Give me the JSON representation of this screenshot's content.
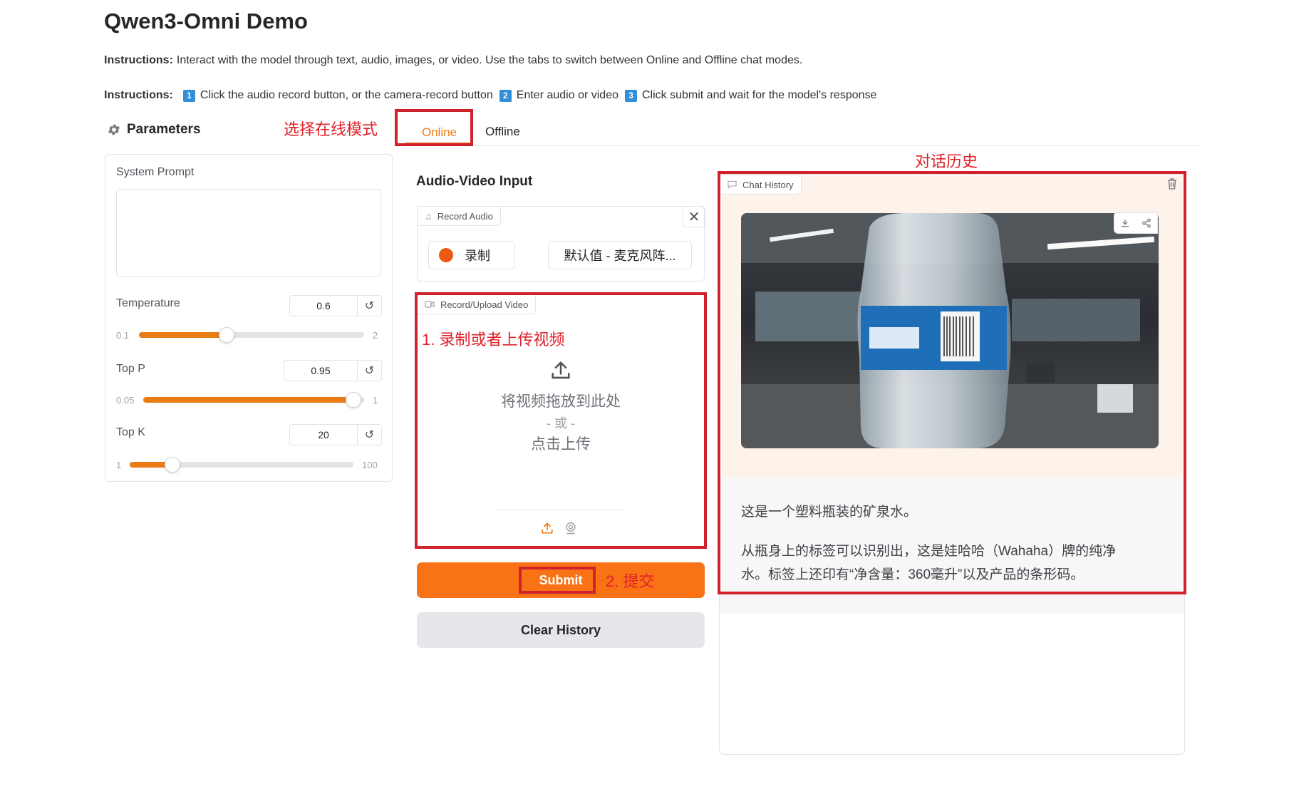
{
  "app": {
    "title": "Qwen3-Omni Demo"
  },
  "instructions": {
    "line1_label": "Instructions:",
    "line1_text": "Interact with the model through text, audio, images, or video. Use the tabs to switch between Online and Offline chat modes.",
    "line2_label": "Instructions:",
    "steps": [
      {
        "num": "1",
        "text": "Click the audio record button, or the camera-record button"
      },
      {
        "num": "2",
        "text": "Enter audio or video"
      },
      {
        "num": "3",
        "text": "Click submit and wait for the model's response"
      }
    ]
  },
  "annotations": {
    "select_online": "选择在线模式",
    "chat_history": "对话历史",
    "record_upload": "1. 录制或者上传视频",
    "submit": "2. 提交",
    "color": "#d0222d"
  },
  "parameters": {
    "header": "Parameters",
    "icon": "gear-icon",
    "system_prompt_label": "System Prompt",
    "system_prompt_value": "",
    "temperature": {
      "label": "Temperature",
      "value": "0.6",
      "min": "0.1",
      "max": "2",
      "fraction": 0.39
    },
    "top_p": {
      "label": "Top P",
      "value": "0.95",
      "min": "0.05",
      "max": "1",
      "fraction": 0.95
    },
    "top_k": {
      "label": "Top K",
      "value": "20",
      "min": "1",
      "max": "100",
      "fraction": 0.19
    },
    "reset_icon": "reset-icon"
  },
  "tabs": [
    {
      "label": "Online",
      "active": true
    },
    {
      "label": "Offline",
      "active": false
    }
  ],
  "input": {
    "section_title": "Audio-Video Input",
    "audio_label": "Record Audio",
    "record_label": "录制",
    "mic_label": "默认值 - 麦克风阵...",
    "video_label": "Record/Upload Video",
    "drop_text": "将视频拖放到此处",
    "or_text": "- 或 -",
    "click_upload": "点击上传"
  },
  "buttons": {
    "submit": "Submit",
    "clear": "Clear History"
  },
  "chat": {
    "label": "Chat History",
    "reply_1": "这是一个塑料瓶装的矿泉水。",
    "reply_2a": "从瓶身上的标签可以识别出，这是娃哈哈（Wahaha）牌的纯净",
    "reply_2b": "水。标签上还印有“净含量：360毫升”以及产品的条形码。"
  },
  "colors": {
    "accent": "#ea7c15",
    "submit_bg": "#f97316",
    "step_badge": "#2f8fd8"
  }
}
